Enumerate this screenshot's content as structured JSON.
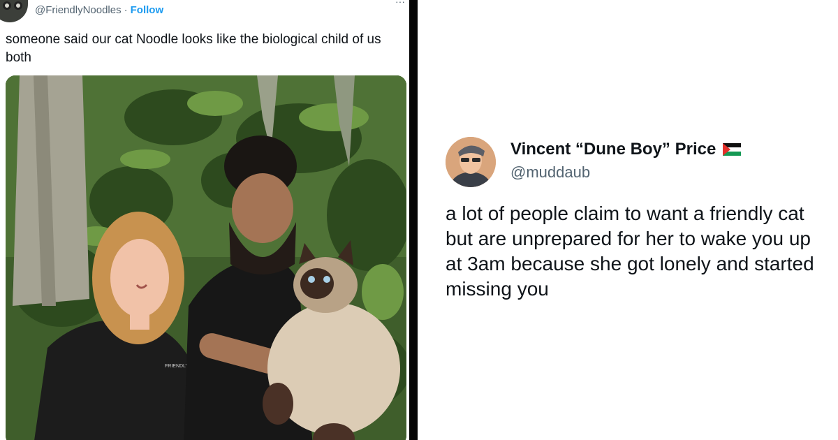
{
  "left_tweet": {
    "handle": "@FriendlyNoodles",
    "separator": "·",
    "follow_label": "Follow",
    "more_glyph": "···",
    "text": "someone said our cat Noodle looks like the biological child of us both",
    "shirt_print": "FRIENDLY",
    "avatar_icon": "avatar-icon",
    "photo_icon": "photo-icon",
    "colors": {
      "follow": "#1d9bf0",
      "handle": "#536471",
      "text": "#0f1419"
    }
  },
  "right_tweet": {
    "display_name": "Vincent “Dune Boy” Price",
    "flag_icon": "palestine-flag-icon",
    "handle": "@muddaub",
    "text": "a lot of people claim to want a friendly cat but are unprepared for her to wake you up at 3am because she got lonely and started missing you",
    "avatar_icon": "avatar-icon",
    "colors": {
      "handle": "#536471",
      "text": "#0f1419"
    }
  }
}
